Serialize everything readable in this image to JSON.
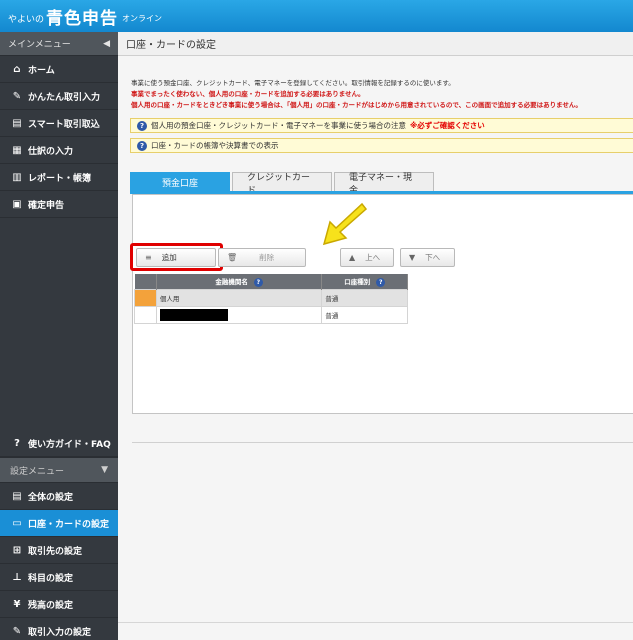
{
  "app": {
    "brand_small": "やよいの",
    "brand_big": "青色申告",
    "brand_online": "オンライン"
  },
  "sidebar": {
    "main_menu_label": "メインメニュー",
    "items": [
      {
        "label": "ホーム",
        "icon": "home-icon"
      },
      {
        "label": "かんたん取引入力",
        "icon": "pencil-icon"
      },
      {
        "label": "スマート取引取込",
        "icon": "import-icon"
      },
      {
        "label": "仕訳の入力",
        "icon": "journal-icon"
      },
      {
        "label": "レポート・帳簿",
        "icon": "report-icon"
      },
      {
        "label": "確定申告",
        "icon": "document-icon"
      }
    ],
    "guide_label": "使い方ガイド・FAQ",
    "settings_menu_label": "設定メニュー",
    "settings_items": [
      {
        "label": "全体の設定",
        "active": false
      },
      {
        "label": "口座・カードの設定",
        "active": true
      },
      {
        "label": "取引先の設定",
        "active": false
      },
      {
        "label": "科目の設定",
        "active": false
      },
      {
        "label": "残高の設定",
        "active": false
      },
      {
        "label": "取引入力の設定",
        "active": false
      }
    ]
  },
  "page": {
    "title": "口座・カードの設定",
    "desc_line1": "事業に使う預金口座、クレジットカード、電子マネーを登録してください。取引情報を記録するのに使います。",
    "desc_line2": "事業でまったく使わない、個人用の口座・カードを追加する必要はありません。",
    "desc_line3": "個人用の口座・カードをときどき事業に使う場合は、「個人用」の口座・カードがはじめから用意されているので、この画面で追加する必要はありません。",
    "notice1": "個人用の預金口座・クレジットカード・電子マネーを事業に使う場合の注意",
    "notice1_warn": "※必ずご確認ください",
    "notice2": "口座・カードの帳簿や決算書での表示"
  },
  "tabs": [
    {
      "label": "預金口座",
      "active": true
    },
    {
      "label": "クレジットカード",
      "active": false
    },
    {
      "label": "電子マネー・現金",
      "active": false
    }
  ],
  "toolbar": {
    "add_label": "追加",
    "delete_label": "削除",
    "up_label": "上へ",
    "down_label": "下へ"
  },
  "table": {
    "columns": [
      "金融機関名",
      "口座種別"
    ],
    "rows": [
      {
        "name": "個人用",
        "type": "普通"
      },
      {
        "name": "",
        "type": "普通"
      }
    ]
  },
  "colors": {
    "accent": "#1a8fd6",
    "highlight": "#e00000",
    "arrow": "#f7e21b"
  }
}
